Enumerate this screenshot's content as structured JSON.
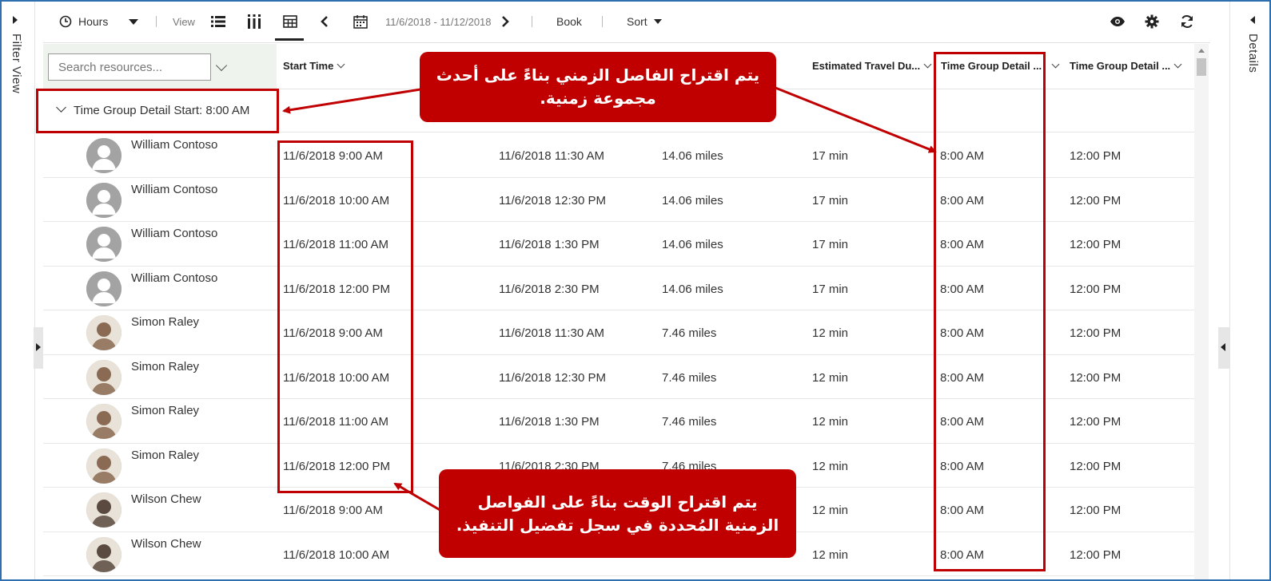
{
  "left_panel": {
    "label": "Filter View"
  },
  "right_panel": {
    "label": "Details"
  },
  "toolbar": {
    "hours_label": "Hours",
    "view_label": "View",
    "date_range": "11/6/2018 - 11/12/2018",
    "book_label": "Book",
    "sort_label": "Sort"
  },
  "search": {
    "placeholder": "Search resources..."
  },
  "columns": [
    "Start Time",
    "Estimated Travel Du...",
    "Time Group Detail ...",
    "Time Group Detail ..."
  ],
  "group": {
    "label": "Time Group Detail Start: 8:00 AM"
  },
  "rows": [
    {
      "name": "William Contoso",
      "start": "11/6/2018 9:00 AM",
      "end": "11/6/2018 11:30 AM",
      "distance": "14.06 miles",
      "travel": "17 min",
      "tg_start": "8:00 AM",
      "tg_end": "12:00 PM"
    },
    {
      "name": "William Contoso",
      "start": "11/6/2018 10:00 AM",
      "end": "11/6/2018 12:30 PM",
      "distance": "14.06 miles",
      "travel": "17 min",
      "tg_start": "8:00 AM",
      "tg_end": "12:00 PM"
    },
    {
      "name": "William Contoso",
      "start": "11/6/2018 11:00 AM",
      "end": "11/6/2018 1:30 PM",
      "distance": "14.06 miles",
      "travel": "17 min",
      "tg_start": "8:00 AM",
      "tg_end": "12:00 PM"
    },
    {
      "name": "William Contoso",
      "start": "11/6/2018 12:00 PM",
      "end": "11/6/2018 2:30 PM",
      "distance": "14.06 miles",
      "travel": "17 min",
      "tg_start": "8:00 AM",
      "tg_end": "12:00 PM"
    },
    {
      "name": "Simon Raley",
      "start": "11/6/2018 9:00 AM",
      "end": "11/6/2018 11:30 AM",
      "distance": "7.46 miles",
      "travel": "12 min",
      "tg_start": "8:00 AM",
      "tg_end": "12:00 PM"
    },
    {
      "name": "Simon Raley",
      "start": "11/6/2018 10:00 AM",
      "end": "11/6/2018 12:30 PM",
      "distance": "7.46 miles",
      "travel": "12 min",
      "tg_start": "8:00 AM",
      "tg_end": "12:00 PM"
    },
    {
      "name": "Simon Raley",
      "start": "11/6/2018 11:00 AM",
      "end": "11/6/2018 1:30 PM",
      "distance": "7.46 miles",
      "travel": "12 min",
      "tg_start": "8:00 AM",
      "tg_end": "12:00 PM"
    },
    {
      "name": "Simon Raley",
      "start": "11/6/2018 12:00 PM",
      "end": "11/6/2018 2:30 PM",
      "distance": "7.46 miles",
      "travel": "12 min",
      "tg_start": "8:00 AM",
      "tg_end": "12:00 PM"
    },
    {
      "name": "Wilson Chew",
      "start": "11/6/2018 9:00 AM",
      "end": "",
      "distance": "",
      "travel": "12 min",
      "tg_start": "8:00 AM",
      "tg_end": "12:00 PM"
    },
    {
      "name": "Wilson Chew",
      "start": "11/6/2018 10:00 AM",
      "end": "",
      "distance": "",
      "travel": "12 min",
      "tg_start": "8:00 AM",
      "tg_end": "12:00 PM"
    }
  ],
  "callouts": {
    "top": "يتم اقتراح الفاصل الزمني بناءً على أحدث مجموعة زمنية.",
    "bottom": "يتم اقتراح الوقت بناءً على الفواصل الزمنية المُحددة في سجل تفضيل التنفيذ."
  },
  "colors": {
    "annotation": "#c00000",
    "frame": "#2f6fb0"
  }
}
